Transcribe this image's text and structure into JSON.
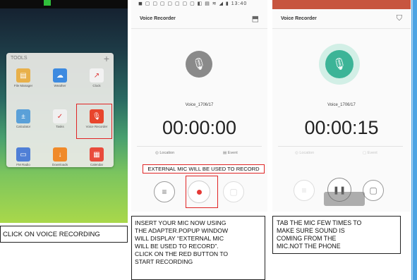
{
  "panel1": {
    "folder_title": "TOOLS",
    "plus_label": "+",
    "apps": [
      {
        "label": "File Manager",
        "color": "#e8b04a",
        "glyph": "▤"
      },
      {
        "label": "Weather",
        "color": "#3d8ae0",
        "glyph": "☁"
      },
      {
        "label": "Clock",
        "color": "#f2f2f2",
        "glyph": "↗"
      },
      {
        "label": "Calculator",
        "color": "#5aa0d8",
        "glyph": "±"
      },
      {
        "label": "Tasks",
        "color": "#f0f0f0",
        "glyph": "✓"
      },
      {
        "label": "Voice Recorder",
        "color": "#e8452c",
        "glyph": "🎙"
      },
      {
        "label": "FM Radio",
        "color": "#4f7fd6",
        "glyph": "▭"
      },
      {
        "label": "Downloads",
        "color": "#f08a2a",
        "glyph": "↓"
      },
      {
        "label": "Calendar",
        "color": "#e94b3c",
        "glyph": "▦"
      }
    ],
    "caption": "CLICK ON VOICE RECORDING"
  },
  "panel2": {
    "status": "◼ ▢ ▢ ▢ ▢ ▢ ▢ ▢   ◧ ▤ ≋ ◢ ▮ 13:40",
    "title": "Voice Recorder",
    "filename": "Voice_1706/17",
    "timer": "00:00:00",
    "location_label": "◎ Location",
    "event_label": "▤ Event",
    "external_notice": "EXTERNAL MIC WILL  BE USED TO RECORD",
    "caption_lines": [
      "INSERT YOUR MIC NOW USING",
      "THE ADAPTER.POPUP WINDOW",
      "WILL DISPLAY “EXTERNAL MIC",
      "WILL BE USED TO RECORD”.",
      "CLICK ON THE RED BUTTON TO",
      "START RECORDING"
    ]
  },
  "panel3": {
    "title": "Voice Recorder",
    "filename": "Voice_1706/17",
    "timer": "00:00:15",
    "location_label": "◎ Location",
    "event_label": "▢ Event",
    "caption_lines": [
      "TAB THE MIC FEW TIMES TO",
      "MAKE SURE SOUND IS",
      "COMING FROM THE",
      "MIC.NOT THE PHONE"
    ]
  },
  "icons": {
    "mic": "🎙",
    "list": "≡",
    "stop": "▢",
    "pause": "❚❚",
    "share": "⬒",
    "bookmark": "⛉"
  },
  "colors": {
    "accent_red": "#e02424",
    "record_red": "#e53935",
    "teal": "#3cb497",
    "status_bar_active": "#c7553f"
  }
}
